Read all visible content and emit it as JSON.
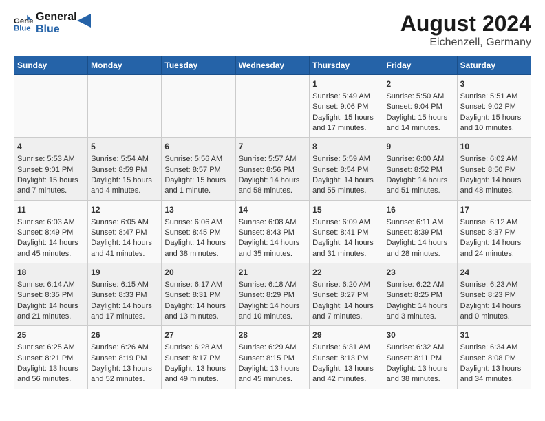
{
  "header": {
    "logo_line1": "General",
    "logo_line2": "Blue",
    "month_year": "August 2024",
    "location": "Eichenzell, Germany"
  },
  "calendar": {
    "days_of_week": [
      "Sunday",
      "Monday",
      "Tuesday",
      "Wednesday",
      "Thursday",
      "Friday",
      "Saturday"
    ],
    "weeks": [
      [
        {
          "day": "",
          "info": ""
        },
        {
          "day": "",
          "info": ""
        },
        {
          "day": "",
          "info": ""
        },
        {
          "day": "",
          "info": ""
        },
        {
          "day": "1",
          "info": "Sunrise: 5:49 AM\nSunset: 9:06 PM\nDaylight: 15 hours and 17 minutes."
        },
        {
          "day": "2",
          "info": "Sunrise: 5:50 AM\nSunset: 9:04 PM\nDaylight: 15 hours and 14 minutes."
        },
        {
          "day": "3",
          "info": "Sunrise: 5:51 AM\nSunset: 9:02 PM\nDaylight: 15 hours and 10 minutes."
        }
      ],
      [
        {
          "day": "4",
          "info": "Sunrise: 5:53 AM\nSunset: 9:01 PM\nDaylight: 15 hours and 7 minutes."
        },
        {
          "day": "5",
          "info": "Sunrise: 5:54 AM\nSunset: 8:59 PM\nDaylight: 15 hours and 4 minutes."
        },
        {
          "day": "6",
          "info": "Sunrise: 5:56 AM\nSunset: 8:57 PM\nDaylight: 15 hours and 1 minute."
        },
        {
          "day": "7",
          "info": "Sunrise: 5:57 AM\nSunset: 8:56 PM\nDaylight: 14 hours and 58 minutes."
        },
        {
          "day": "8",
          "info": "Sunrise: 5:59 AM\nSunset: 8:54 PM\nDaylight: 14 hours and 55 minutes."
        },
        {
          "day": "9",
          "info": "Sunrise: 6:00 AM\nSunset: 8:52 PM\nDaylight: 14 hours and 51 minutes."
        },
        {
          "day": "10",
          "info": "Sunrise: 6:02 AM\nSunset: 8:50 PM\nDaylight: 14 hours and 48 minutes."
        }
      ],
      [
        {
          "day": "11",
          "info": "Sunrise: 6:03 AM\nSunset: 8:49 PM\nDaylight: 14 hours and 45 minutes."
        },
        {
          "day": "12",
          "info": "Sunrise: 6:05 AM\nSunset: 8:47 PM\nDaylight: 14 hours and 41 minutes."
        },
        {
          "day": "13",
          "info": "Sunrise: 6:06 AM\nSunset: 8:45 PM\nDaylight: 14 hours and 38 minutes."
        },
        {
          "day": "14",
          "info": "Sunrise: 6:08 AM\nSunset: 8:43 PM\nDaylight: 14 hours and 35 minutes."
        },
        {
          "day": "15",
          "info": "Sunrise: 6:09 AM\nSunset: 8:41 PM\nDaylight: 14 hours and 31 minutes."
        },
        {
          "day": "16",
          "info": "Sunrise: 6:11 AM\nSunset: 8:39 PM\nDaylight: 14 hours and 28 minutes."
        },
        {
          "day": "17",
          "info": "Sunrise: 6:12 AM\nSunset: 8:37 PM\nDaylight: 14 hours and 24 minutes."
        }
      ],
      [
        {
          "day": "18",
          "info": "Sunrise: 6:14 AM\nSunset: 8:35 PM\nDaylight: 14 hours and 21 minutes."
        },
        {
          "day": "19",
          "info": "Sunrise: 6:15 AM\nSunset: 8:33 PM\nDaylight: 14 hours and 17 minutes."
        },
        {
          "day": "20",
          "info": "Sunrise: 6:17 AM\nSunset: 8:31 PM\nDaylight: 14 hours and 13 minutes."
        },
        {
          "day": "21",
          "info": "Sunrise: 6:18 AM\nSunset: 8:29 PM\nDaylight: 14 hours and 10 minutes."
        },
        {
          "day": "22",
          "info": "Sunrise: 6:20 AM\nSunset: 8:27 PM\nDaylight: 14 hours and 7 minutes."
        },
        {
          "day": "23",
          "info": "Sunrise: 6:22 AM\nSunset: 8:25 PM\nDaylight: 14 hours and 3 minutes."
        },
        {
          "day": "24",
          "info": "Sunrise: 6:23 AM\nSunset: 8:23 PM\nDaylight: 14 hours and 0 minutes."
        }
      ],
      [
        {
          "day": "25",
          "info": "Sunrise: 6:25 AM\nSunset: 8:21 PM\nDaylight: 13 hours and 56 minutes."
        },
        {
          "day": "26",
          "info": "Sunrise: 6:26 AM\nSunset: 8:19 PM\nDaylight: 13 hours and 52 minutes."
        },
        {
          "day": "27",
          "info": "Sunrise: 6:28 AM\nSunset: 8:17 PM\nDaylight: 13 hours and 49 minutes."
        },
        {
          "day": "28",
          "info": "Sunrise: 6:29 AM\nSunset: 8:15 PM\nDaylight: 13 hours and 45 minutes."
        },
        {
          "day": "29",
          "info": "Sunrise: 6:31 AM\nSunset: 8:13 PM\nDaylight: 13 hours and 42 minutes."
        },
        {
          "day": "30",
          "info": "Sunrise: 6:32 AM\nSunset: 8:11 PM\nDaylight: 13 hours and 38 minutes."
        },
        {
          "day": "31",
          "info": "Sunrise: 6:34 AM\nSunset: 8:08 PM\nDaylight: 13 hours and 34 minutes."
        }
      ]
    ]
  }
}
